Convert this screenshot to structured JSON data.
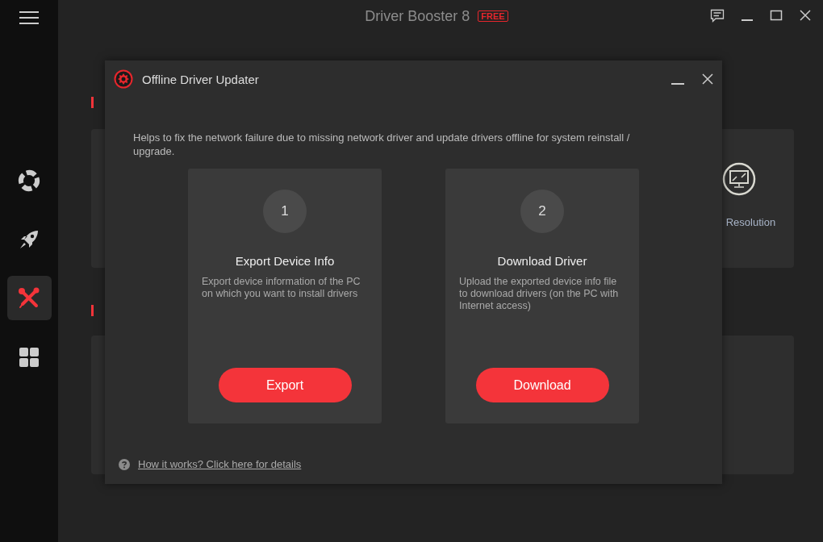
{
  "window": {
    "title": "Driver Booster 8",
    "badge": "FREE"
  },
  "sidebar": {
    "items": [
      {
        "kind": "lifebuoy",
        "selected": false
      },
      {
        "kind": "rocket",
        "selected": false
      },
      {
        "kind": "tools",
        "selected": true
      },
      {
        "kind": "grid",
        "selected": false
      }
    ]
  },
  "tools": {
    "cards": [
      {
        "label": "Resolution"
      }
    ]
  },
  "dialog": {
    "title": "Offline Driver Updater",
    "description": "Helps to fix the network failure due to missing network driver and update drivers offline for system reinstall / upgrade.",
    "steps": [
      {
        "number": "1",
        "title": "Export Device Info",
        "text": "Export device information of the PC on which you want to install drivers",
        "button": "Export"
      },
      {
        "number": "2",
        "title": "Download Driver",
        "text": "Upload the exported device info file to download drivers (on the PC with Internet access)",
        "button": "Download"
      }
    ],
    "help_link": "How it works? Click here for details"
  }
}
